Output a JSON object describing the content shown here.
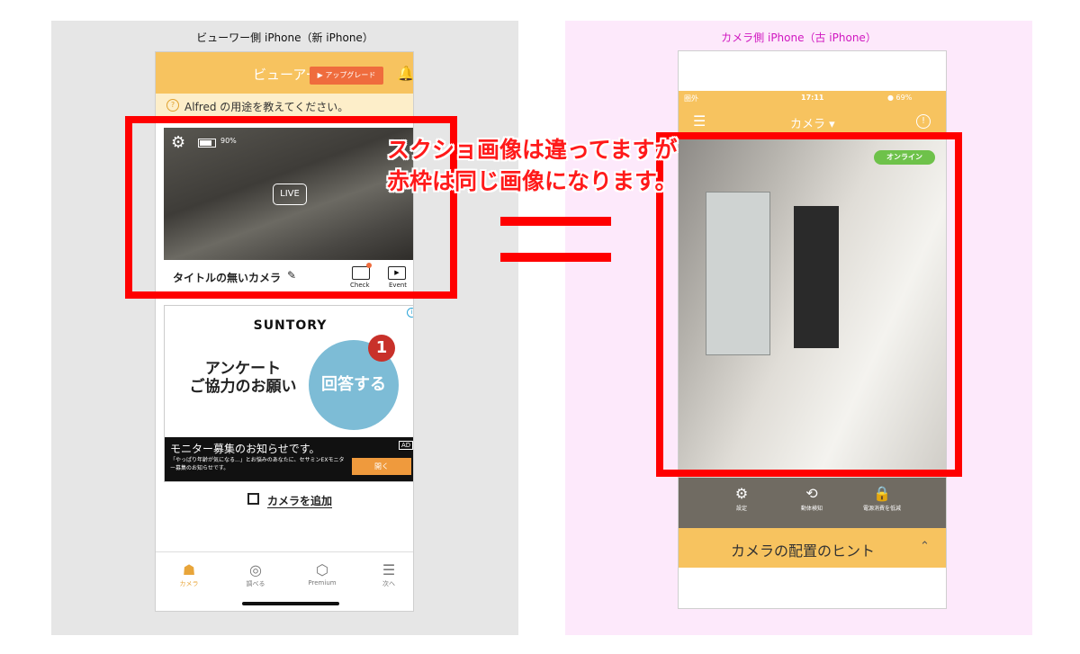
{
  "captions": {
    "left": "ビューワー側 iPhone（新 iPhone）",
    "right": "カメラ側 iPhone（古 iPhone）"
  },
  "viewer": {
    "header_title": "ビューアー",
    "upgrade_label": "▶ アップグレード",
    "banner_text": "Alfred の用途を教えてください。",
    "camera": {
      "battery": "90%",
      "live": "LIVE",
      "name": "タイトルの無いカメラ",
      "check_label": "Check",
      "event_label": "Event"
    },
    "ad": {
      "brand": "SUNTORY",
      "headline_line1": "アンケート",
      "headline_line2": "ご協力のお願い",
      "cta_circle": "回答する",
      "badge": "1",
      "tag": "AD",
      "bar_title": "モニター募集のお知らせです。",
      "bar_sub": "「やっぱり年齢が気になる...」とお悩みのあなたに、セサミンEXモニター募集のお知らせです。",
      "bar_cta": "開く"
    },
    "add_camera": "カメラを追加",
    "tabs": [
      {
        "label": "カメラ"
      },
      {
        "label": "調べる"
      },
      {
        "label": "Premium"
      },
      {
        "label": "次へ"
      }
    ]
  },
  "camera_side": {
    "status_left": "圏外",
    "status_time": "17:11",
    "status_right": "● 69%",
    "title": "カメラ ▾",
    "online": "オンライン",
    "controls": [
      {
        "label": "設定"
      },
      {
        "label": "動体検知"
      },
      {
        "label": "電源消費を低減"
      }
    ],
    "hint": "カメラの配置のヒント"
  },
  "callout": {
    "line1": "スクショ画像は違ってますが",
    "line2": "赤枠は同じ画像になります。"
  },
  "colors": {
    "accent": "#f7c35f",
    "red": "#ff0000",
    "online": "#6ec24a"
  }
}
